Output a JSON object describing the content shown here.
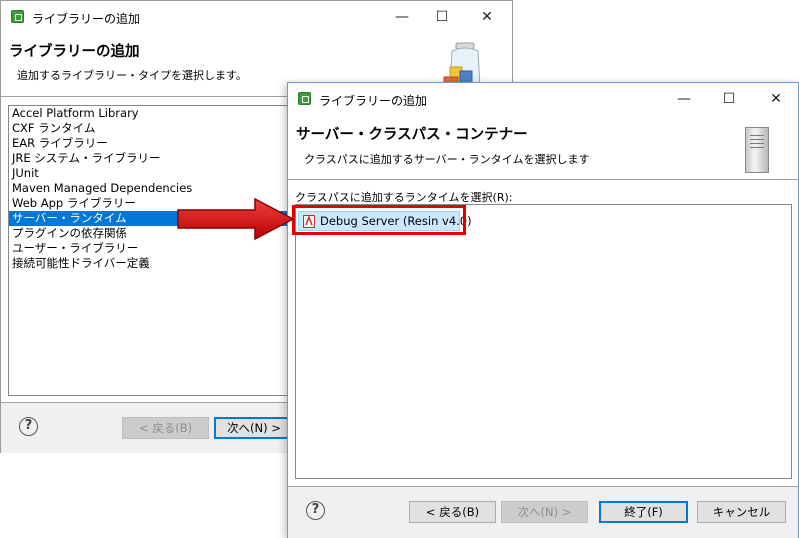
{
  "back_dialog": {
    "title": "ライブラリーの追加",
    "header_title": "ライブラリーの追加",
    "header_desc": "追加するライブラリー・タイプを選択します。",
    "items": [
      "Accel Platform Library",
      "CXF ランタイム",
      "EAR ライブラリー",
      "JRE システム・ライブラリー",
      "JUnit",
      "Maven Managed Dependencies",
      "Web App ライブラリー",
      "サーバー・ランタイム",
      "プラグインの依存関係",
      "ユーザー・ライブラリー",
      "接続可能性ドライバー定義"
    ],
    "selected_index": 7,
    "back_button": "< 戻る(B)",
    "next_button": "次へ(N) >",
    "help": "?"
  },
  "front_dialog": {
    "title": "ライブラリーの追加",
    "header_title": "サーバー・クラスパス・コンテナー",
    "header_desc": "クラスパスに追加するサーバー・ランタイムを選択します",
    "list_label": "クラスパスに追加するランタイムを選択(R):",
    "runtime_item": "Debug Server (Resin v4.0)",
    "back_button": "< 戻る(B)",
    "next_button": "次へ(N) >",
    "finish_button": "終了(F)",
    "cancel_button": "キャンセル",
    "help": "?"
  },
  "window_controls": {
    "minimize": "—",
    "maximize": "☐",
    "close": "✕"
  },
  "colors": {
    "selection": "#0078d7",
    "highlight_border": "#e00000",
    "arrow": "#d40000"
  }
}
